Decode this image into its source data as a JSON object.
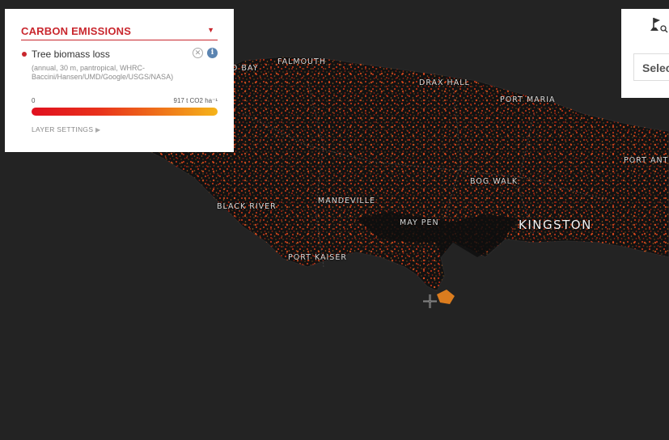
{
  "panel": {
    "title": "CARBON EMISSIONS",
    "collapse_icon": "triangle-down-icon",
    "layer": {
      "name": "Tree biomass loss",
      "description": "(annual, 30 m, pantropical, WHRC-Baccini/Hansen/UMD/Google/USGS/NASA)",
      "color": "#c9272e",
      "close_icon": "close-circle-icon",
      "info_icon": "info-icon"
    },
    "legend": {
      "min_label": "0",
      "max_label": "917 t CO2 ha⁻¹",
      "colors": [
        "#e0101f",
        "#f5b41a"
      ]
    },
    "layer_settings_label": "LAYER SETTINGS",
    "layer_settings_icon": "triangle-right-icon"
  },
  "right_panel": {
    "flag_icon": "flag-search-icon",
    "select_label": "Selec"
  },
  "map": {
    "places": {
      "bay": "D BAY",
      "falmouth": "FALMOUTH",
      "drax_hall": "DRAX HALL",
      "port_maria": "PORT MARIA",
      "port_antonio": "PORT ANT",
      "bog_walk": "BOG WALK",
      "mandeville": "MANDEVILLE",
      "black_river": "BLACK RIVER",
      "may_pen": "MAY PEN",
      "kingston": "KINGSTON",
      "port_kaiser": "PORT KAISER"
    },
    "land_color": "#111111",
    "loss_color": "#e0401a",
    "cursor_icon": "crosshair-icon"
  }
}
